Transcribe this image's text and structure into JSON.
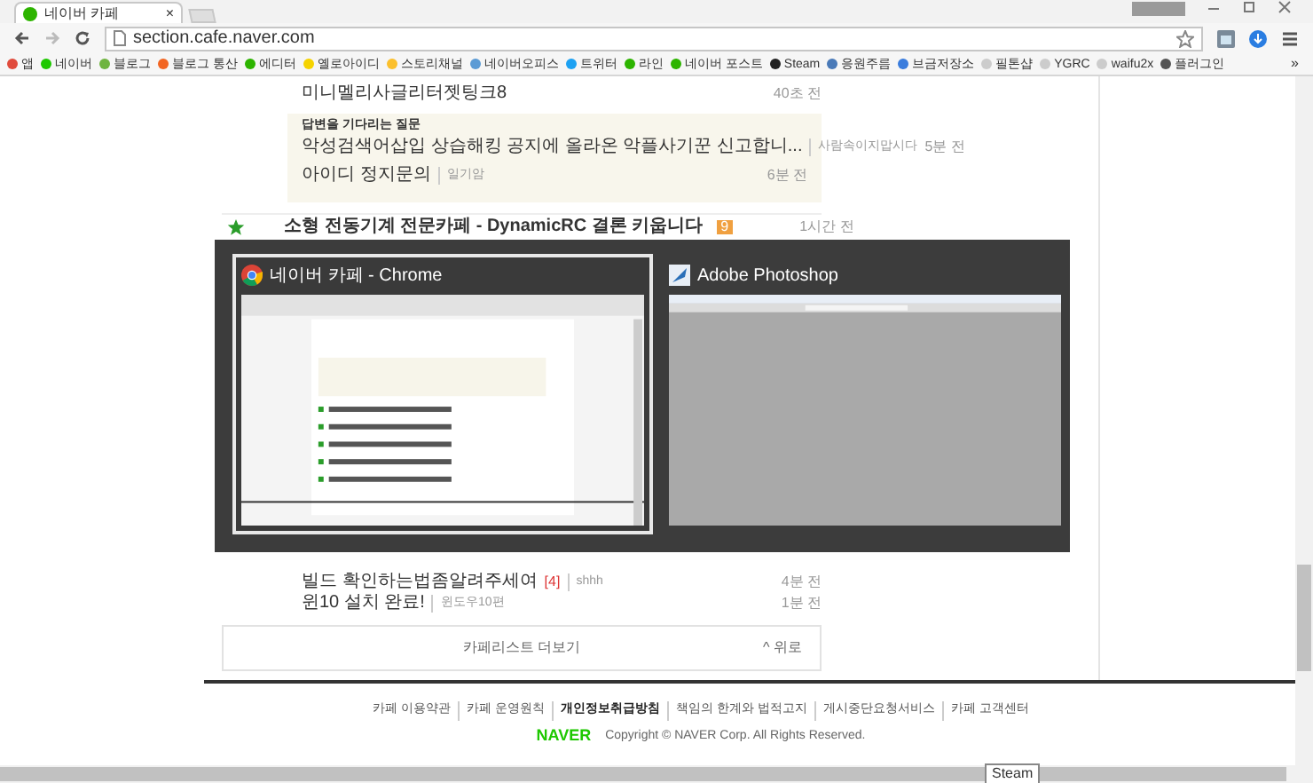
{
  "tab": {
    "title": "네이버 카페",
    "close": "×"
  },
  "address": "section.cafe.naver.com",
  "bookmarks": [
    {
      "label": "앱"
    },
    {
      "label": "네이버"
    },
    {
      "label": "블로그"
    },
    {
      "label": "블로그 통산"
    },
    {
      "label": "에디터"
    },
    {
      "label": "옐로아이디"
    },
    {
      "label": "스토리채널"
    },
    {
      "label": "네이버오피스"
    },
    {
      "label": "트위터"
    },
    {
      "label": "라인"
    },
    {
      "label": "네이버 포스트"
    },
    {
      "label": "Steam"
    },
    {
      "label": "응원주름"
    },
    {
      "label": "브금저장소"
    },
    {
      "label": "필톤샵"
    },
    {
      "label": "YGRC"
    },
    {
      "label": "waifu2x"
    },
    {
      "label": "플러그인"
    }
  ],
  "bookmarks_more": "»",
  "top_posts": [
    {
      "title": "미니멜리사글리터젯팅크8",
      "time": "40초 전"
    }
  ],
  "questions": {
    "heading": "답변을 기다리는 질문",
    "items": [
      {
        "title": "악성검색어삽입 상습해킹 공지에 올라온 악플사기꾼 신고합니...",
        "author": "사람속이지맙시다",
        "time": "5분 전"
      },
      {
        "title": "아이디 정지문의",
        "author": "일기암",
        "time": "6분 전"
      }
    ]
  },
  "featured": {
    "title": "소형 전동기계 전문카페 - DynamicRC 결론 키웁니다",
    "count": "9",
    "time": "1시간 전"
  },
  "bottom_posts": [
    {
      "title": "빌드 확인하는법좀알려주세여",
      "count": "[4]",
      "author": "shhh",
      "time": "4분 전"
    },
    {
      "title": "윈10 설치 완료!",
      "author": "윈도우10편",
      "time": "1분 전"
    }
  ],
  "more": {
    "label": "카페리스트 더보기",
    "top": "^ 위로"
  },
  "footer": {
    "links": [
      {
        "label": "카페 이용약관",
        "bold": false
      },
      {
        "label": "카페 운영원칙",
        "bold": false
      },
      {
        "label": "개인정보취급방침",
        "bold": true
      },
      {
        "label": "책임의 한계와 법적고지",
        "bold": false
      },
      {
        "label": "게시중단요청서비스",
        "bold": false
      },
      {
        "label": "카페 고객센터",
        "bold": false
      }
    ],
    "logo": "NAVER",
    "copyright": "Copyright © NAVER Corp. All Rights Reserved."
  },
  "switcher": [
    {
      "title": "네이버 카페 - Chrome",
      "kind": "chrome",
      "selected": true
    },
    {
      "title": "Adobe Photoshop",
      "kind": "photoshop",
      "selected": false
    }
  ],
  "tooltip": "Steam"
}
